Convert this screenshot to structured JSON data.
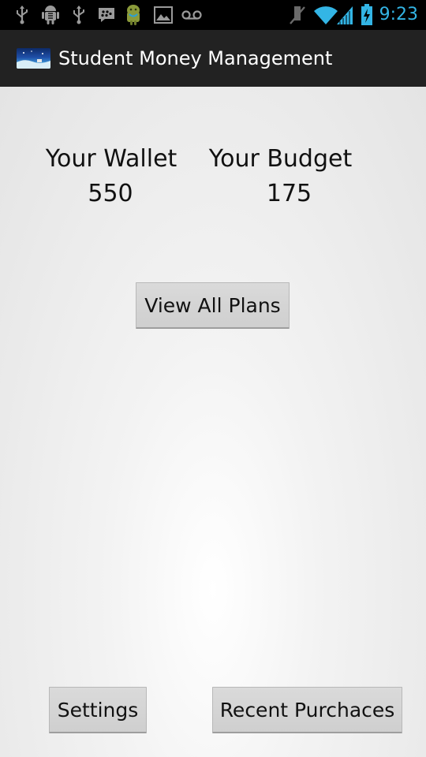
{
  "status_bar": {
    "time": "9:23",
    "icons": [
      "usb-icon",
      "android-debug-icon",
      "usb-icon",
      "bbm-icon",
      "android-robot-icon",
      "gallery-icon",
      "voicemail-icon",
      "mute-icon",
      "wifi-icon",
      "signal-icon",
      "battery-charging-icon"
    ],
    "accent_color": "#33b5e5"
  },
  "action_bar": {
    "title": "Student Money Management",
    "icon": "app-landscape-icon"
  },
  "wallet": {
    "label": "Your Wallet",
    "value": "550"
  },
  "budget": {
    "label": "Your Budget",
    "value": "175"
  },
  "buttons": {
    "view_all_plans": "View All Plans",
    "settings": "Settings",
    "recent_purchases": "Recent Purchaces"
  }
}
